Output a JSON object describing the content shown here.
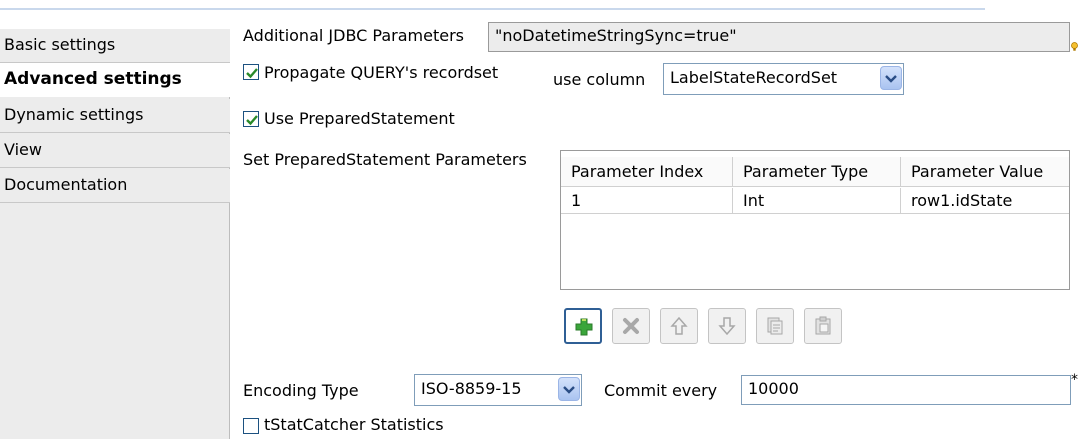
{
  "sidebar": {
    "tabs": [
      {
        "label": "Basic settings",
        "active": false
      },
      {
        "label": "Advanced settings",
        "active": true
      },
      {
        "label": "Dynamic settings",
        "active": false
      },
      {
        "label": "View",
        "active": false
      },
      {
        "label": "Documentation",
        "active": false
      }
    ]
  },
  "jdbc": {
    "label": "Additional JDBC Parameters",
    "value": "\"noDatetimeStringSync=true\""
  },
  "propagate": {
    "label": "Propagate QUERY's recordset",
    "checked": true,
    "use_column_label": "use column",
    "column_value": "LabelStateRecordSet"
  },
  "prepared": {
    "label": "Use PreparedStatement",
    "checked": true
  },
  "params": {
    "label": "Set PreparedStatement Parameters",
    "headers": [
      "Parameter Index",
      "Parameter Type",
      "Parameter Value"
    ],
    "rows": [
      [
        "1",
        "Int",
        "row1.idState"
      ]
    ]
  },
  "toolbar": [
    "add-icon",
    "remove-icon",
    "move-up-icon",
    "move-down-icon",
    "copy-icon",
    "paste-icon"
  ],
  "encoding": {
    "label": "Encoding Type",
    "value": "ISO-8859-15"
  },
  "commit": {
    "label": "Commit every",
    "value": "10000",
    "required_marker": "*"
  },
  "statcatcher": {
    "label": "tStatCatcher Statistics",
    "checked": false
  },
  "colors": {
    "accent": "#2f5f95",
    "check": "#2a8a2a",
    "add": "#3aa53a"
  }
}
